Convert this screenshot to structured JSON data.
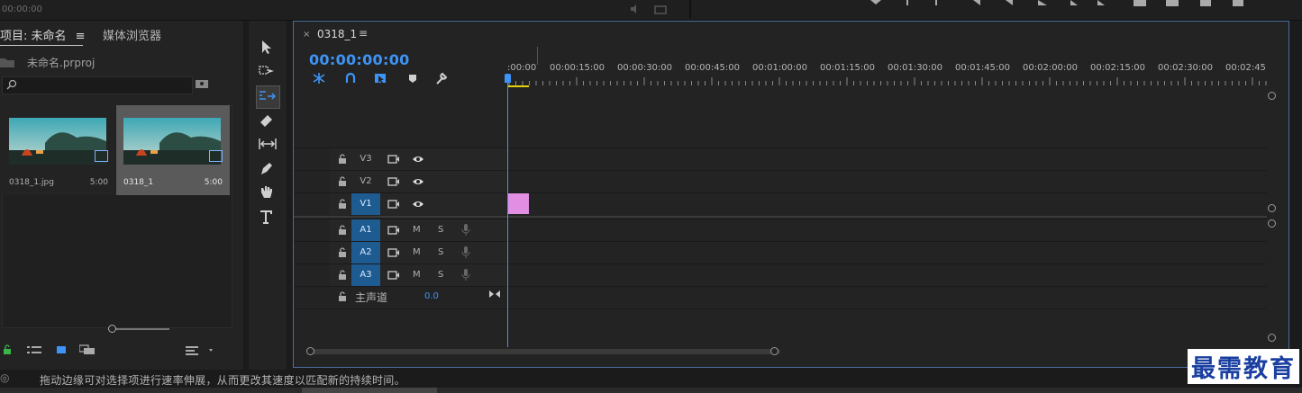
{
  "top": {
    "timecode": "00:00:00"
  },
  "project": {
    "tab_project": "项目: 未命名",
    "tab_menu": "≡",
    "tab_media": "媒体浏览器",
    "file_name": "未命名.prproj",
    "search_placeholder": "",
    "clips": [
      {
        "name": "0318_1.jpg",
        "duration": "5:00"
      },
      {
        "name": "0318_1",
        "duration": "5:00"
      }
    ]
  },
  "timeline": {
    "sequence_tab": "0318_1",
    "close": "×",
    "menu": "≡",
    "timecode": "00:00:00:00",
    "ruler_labels": [
      ":00:00",
      "00:00:15:00",
      "00:00:30:00",
      "00:00:45:00",
      "00:01:00:00",
      "00:01:15:00",
      "00:01:30:00",
      "00:01:45:00",
      "00:02:00:00",
      "00:02:15:00",
      "00:02:30:00",
      "00:02:45:"
    ],
    "video_tracks": [
      "V3",
      "V2",
      "V1"
    ],
    "audio_tracks": [
      "A1",
      "A2",
      "A3"
    ],
    "mute_label": "M",
    "solo_label": "S",
    "master_label": "主声道",
    "master_value": "0.0"
  },
  "status": {
    "text": "拖动边缘可对选择项进行速率伸展，从而更改其速度以匹配新的持续时间。"
  },
  "watermark": "最需教育",
  "colors": {
    "accent": "#3d94f6",
    "clip_v1": "#e28ee3",
    "track_on": "#1d5b91",
    "work_area": "#e4d20e"
  }
}
